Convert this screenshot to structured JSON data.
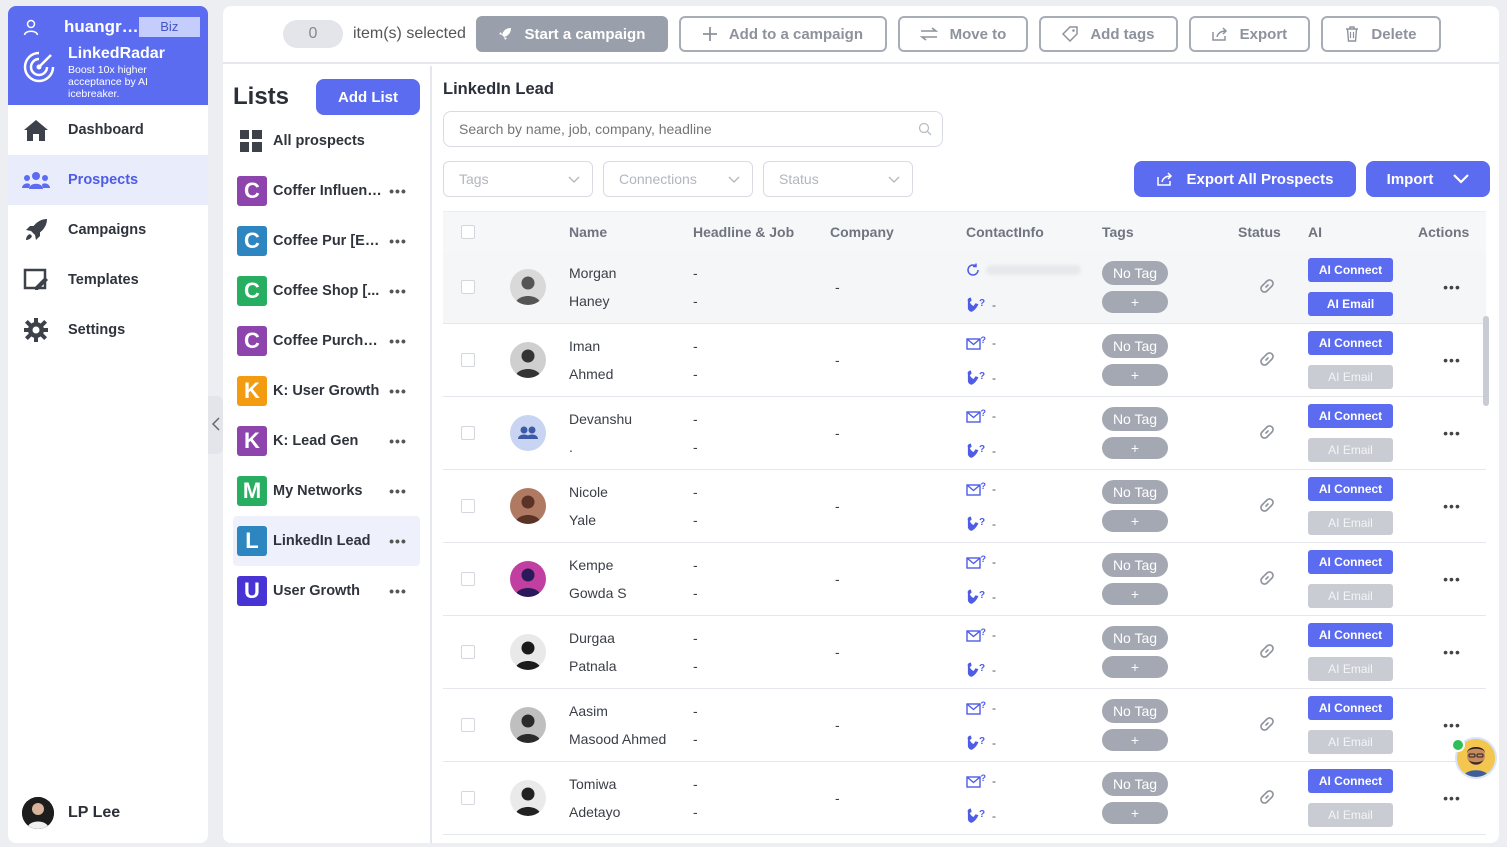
{
  "sidebar": {
    "username": "huangr…",
    "plan_badge": "Biz",
    "brand_title": "LinkedRadar",
    "brand_subtitle": "Boost 10x higher acceptance by AI icebreaker.",
    "nav": [
      {
        "label": "Dashboard",
        "icon": "home-icon",
        "active": false
      },
      {
        "label": "Prospects",
        "icon": "users-icon",
        "active": true
      },
      {
        "label": "Campaigns",
        "icon": "rocket-icon",
        "active": false
      },
      {
        "label": "Templates",
        "icon": "template-icon",
        "active": false
      },
      {
        "label": "Settings",
        "icon": "gear-icon",
        "active": false
      }
    ],
    "footer_name": "LP Lee"
  },
  "toolbar": {
    "selected_count": "0",
    "selected_label": "item(s) selected",
    "start_campaign": "Start a campaign",
    "add_to_campaign": "Add to a campaign",
    "move_to": "Move to",
    "add_tags": "Add tags",
    "export": "Export",
    "delete": "Delete"
  },
  "lists": {
    "title": "Lists",
    "add_button": "Add List",
    "all_prospects": "All prospects",
    "items": [
      {
        "letter": "C",
        "name": "Coffer Influen…",
        "color": "#8e44ad",
        "active": false
      },
      {
        "letter": "C",
        "name": "Coffee Pur [E…",
        "color": "#2e86c1",
        "active": false
      },
      {
        "letter": "C",
        "name": "Coffee Shop [...",
        "color": "#27ae60",
        "active": false
      },
      {
        "letter": "C",
        "name": "Coffee Purcha…",
        "color": "#8e44ad",
        "active": false
      },
      {
        "letter": "K",
        "name": "K: User Growth",
        "color": "#f39c12",
        "active": false
      },
      {
        "letter": "K",
        "name": "K: Lead Gen",
        "color": "#8e44ad",
        "active": false
      },
      {
        "letter": "M",
        "name": "My Networks",
        "color": "#27ae60",
        "active": false
      },
      {
        "letter": "L",
        "name": "LinkedIn Lead",
        "color": "#2e86c1",
        "active": true
      },
      {
        "letter": "U",
        "name": "User Growth",
        "color": "#4834d4",
        "active": false
      }
    ]
  },
  "content": {
    "title": "LinkedIn Lead",
    "search_placeholder": "Search by name, job, company, headline",
    "filters": {
      "tags": "Tags",
      "connections": "Connections",
      "status": "Status"
    },
    "export_all": "Export All Prospects",
    "import": "Import"
  },
  "table": {
    "headers": {
      "name": "Name",
      "job": "Headline & Job",
      "company": "Company",
      "contact": "ContactInfo",
      "tags": "Tags",
      "status": "Status",
      "ai": "AI",
      "actions": "Actions"
    },
    "no_tag": "No Tag",
    "add_tag": "+",
    "ai_connect": "AI Connect",
    "ai_email": "AI Email",
    "dash": "-",
    "phone_q": "?",
    "rows": [
      {
        "first": "Morgan",
        "last": "Haney",
        "avatar_bg": "#d9d9d9",
        "avatar_fg": "#555",
        "email_enabled": true
      },
      {
        "first": "Iman",
        "last": "Ahmed",
        "avatar_bg": "#cfcfcf",
        "avatar_fg": "#333",
        "email_enabled": false
      },
      {
        "first": "Devanshu",
        "last": ".",
        "avatar_bg": "#c8d4f2",
        "avatar_fg": "#3d5aa8",
        "email_enabled": false
      },
      {
        "first": "Nicole",
        "last": "Yale",
        "avatar_bg": "#b07a62",
        "avatar_fg": "#5a3326",
        "email_enabled": false
      },
      {
        "first": "Kempe",
        "last": "Gowda S",
        "avatar_bg": "#c03fa0",
        "avatar_fg": "#2a1a5a",
        "email_enabled": false
      },
      {
        "first": "Durgaa",
        "last": "Patnala",
        "avatar_bg": "#e9e9e9",
        "avatar_fg": "#1a1a1a",
        "email_enabled": false
      },
      {
        "first": "Aasim",
        "last": "Masood Ahmed",
        "avatar_bg": "#bfbfbf",
        "avatar_fg": "#2a2a2a",
        "email_enabled": false
      },
      {
        "first": "Tomiwa",
        "last": "Adetayo",
        "avatar_bg": "#eaeaea",
        "avatar_fg": "#222",
        "email_enabled": false
      }
    ]
  }
}
